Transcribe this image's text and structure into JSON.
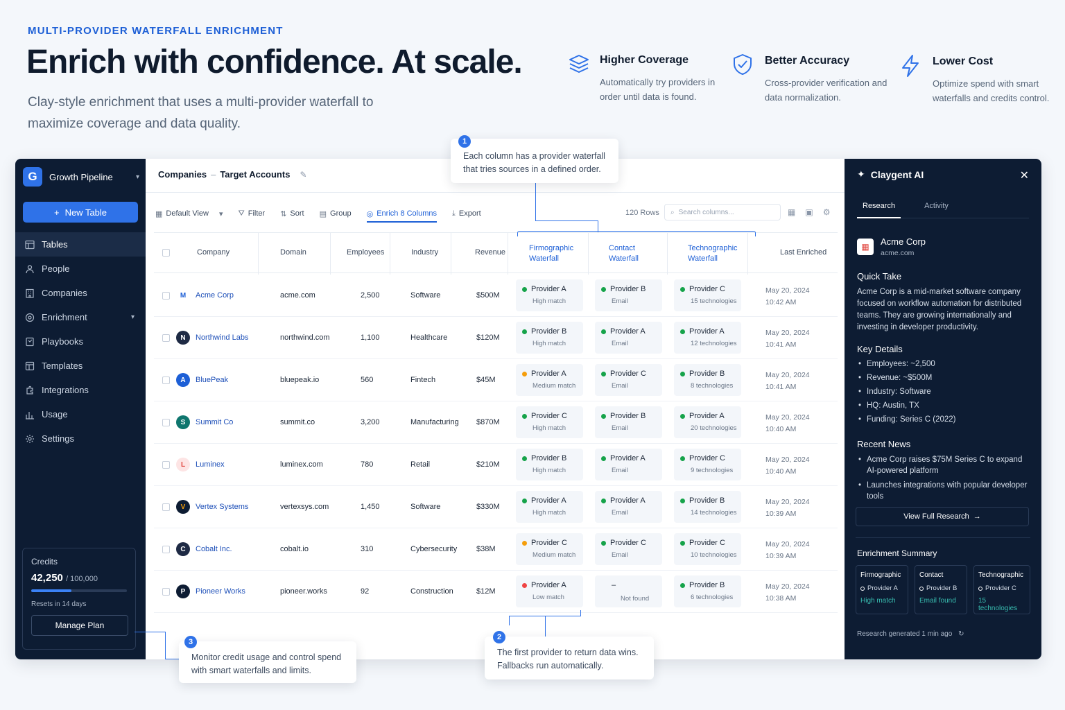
{
  "hero": {
    "eyebrow": "MULTI-PROVIDER WATERFALL ENRICHMENT",
    "title": "Enrich with confidence. At scale.",
    "subtitle": "Clay-style enrichment that uses a multi-provider waterfall to maximize coverage and data quality."
  },
  "features": [
    {
      "icon": "layers-icon",
      "title": "Higher Coverage",
      "desc": "Automatically try providers in order until data is found."
    },
    {
      "icon": "shield-check-icon",
      "title": "Better Accuracy",
      "desc": "Cross-provider verification and data normalization."
    },
    {
      "icon": "lightning-icon",
      "title": "Lower Cost",
      "desc": "Optimize spend with smart waterfalls and credits control."
    }
  ],
  "sidebar": {
    "workspace_initial": "G",
    "workspace": "Growth Pipeline",
    "new_table": "New Table",
    "items": [
      {
        "label": "Tables",
        "icon": "table-icon"
      },
      {
        "label": "People",
        "icon": "people-icon"
      },
      {
        "label": "Companies",
        "icon": "building-icon"
      },
      {
        "label": "Enrichment",
        "icon": "target-icon"
      },
      {
        "label": "Playbooks",
        "icon": "book-icon"
      },
      {
        "label": "Templates",
        "icon": "template-icon"
      },
      {
        "label": "Integrations",
        "icon": "puzzle-icon"
      },
      {
        "label": "Usage",
        "icon": "bar-chart-icon"
      },
      {
        "label": "Settings",
        "icon": "gear-icon"
      }
    ],
    "credits": {
      "label": "Credits",
      "value": "42,250",
      "total": "/ 100,000",
      "used_fraction": 0.4225,
      "reset": "Resets in 14 days",
      "manage": "Manage Plan"
    }
  },
  "table": {
    "breadcrumb_parent": "Companies",
    "breadcrumb_sep": "–",
    "breadcrumb_current": "Target Accounts",
    "toolbar": [
      "Default View",
      "Filter",
      "Sort",
      "Group",
      "Enrich 8 Columns",
      "Export"
    ],
    "rows_count": "120 Rows",
    "search_placeholder": "Search columns...",
    "headers": {
      "company": "Company",
      "domain": "Domain",
      "employees": "Employees",
      "industry": "Industry",
      "revenue": "Revenue",
      "firmo": "Firmographic Waterfall",
      "contact": "Contact Waterfall",
      "techno": "Technographic Waterfall",
      "last": "Last Enriched"
    },
    "rows": [
      {
        "company": "Acme Corp",
        "domain": "acme.com",
        "employees": "2,500",
        "industry": "Software",
        "revenue": "$500M",
        "firmo": {
          "provider": "Provider A",
          "status": "High match",
          "color": "#16a34a"
        },
        "contact": {
          "provider": "Provider B",
          "status": "Email",
          "color": "#16a34a"
        },
        "techno": {
          "provider": "Provider C",
          "status": "15 technologies",
          "color": "#16a34a"
        },
        "date": "May 20, 2024",
        "time": "10:42 AM",
        "logo": "M",
        "logo_bg": "#ffffff",
        "logo_fg": "#1d5fd6"
      },
      {
        "company": "Northwind Labs",
        "domain": "northwind.com",
        "employees": "1,100",
        "industry": "Healthcare",
        "revenue": "$120M",
        "firmo": {
          "provider": "Provider B",
          "status": "High match",
          "color": "#16a34a"
        },
        "contact": {
          "provider": "Provider A",
          "status": "Email",
          "color": "#16a34a"
        },
        "techno": {
          "provider": "Provider A",
          "status": "12 technologies",
          "color": "#16a34a"
        },
        "date": "May 20, 2024",
        "time": "10:41 AM",
        "logo": "N",
        "logo_bg": "#1e2a44",
        "logo_fg": "#ffffff"
      },
      {
        "company": "BluePeak",
        "domain": "bluepeak.io",
        "employees": "560",
        "industry": "Fintech",
        "revenue": "$45M",
        "firmo": {
          "provider": "Provider A",
          "status": "Medium match",
          "color": "#f59e0b"
        },
        "contact": {
          "provider": "Provider C",
          "status": "Email",
          "color": "#16a34a"
        },
        "techno": {
          "provider": "Provider B",
          "status": "8 technologies",
          "color": "#16a34a"
        },
        "date": "May 20, 2024",
        "time": "10:41 AM",
        "logo": "A",
        "logo_bg": "#1d5fd6",
        "logo_fg": "#ffffff"
      },
      {
        "company": "Summit Co",
        "domain": "summit.co",
        "employees": "3,200",
        "industry": "Manufacturing",
        "revenue": "$870M",
        "firmo": {
          "provider": "Provider C",
          "status": "High match",
          "color": "#16a34a"
        },
        "contact": {
          "provider": "Provider B",
          "status": "Email",
          "color": "#16a34a"
        },
        "techno": {
          "provider": "Provider A",
          "status": "20 technologies",
          "color": "#16a34a"
        },
        "date": "May 20, 2024",
        "time": "10:40 AM",
        "logo": "S",
        "logo_bg": "#0f766e",
        "logo_fg": "#ffffff"
      },
      {
        "company": "Luminex",
        "domain": "luminex.com",
        "employees": "780",
        "industry": "Retail",
        "revenue": "$210M",
        "firmo": {
          "provider": "Provider B",
          "status": "High match",
          "color": "#16a34a"
        },
        "contact": {
          "provider": "Provider A",
          "status": "Email",
          "color": "#16a34a"
        },
        "techno": {
          "provider": "Provider C",
          "status": "9 technologies",
          "color": "#16a34a"
        },
        "date": "May 20, 2024",
        "time": "10:40 AM",
        "logo": "L",
        "logo_bg": "#fde4e4",
        "logo_fg": "#e0453e"
      },
      {
        "company": "Vertex Systems",
        "domain": "vertexsys.com",
        "employees": "1,450",
        "industry": "Software",
        "revenue": "$330M",
        "firmo": {
          "provider": "Provider A",
          "status": "High match",
          "color": "#16a34a"
        },
        "contact": {
          "provider": "Provider A",
          "status": "Email",
          "color": "#16a34a"
        },
        "techno": {
          "provider": "Provider B",
          "status": "14 technologies",
          "color": "#16a34a"
        },
        "date": "May 20, 2024",
        "time": "10:39 AM",
        "logo": "V",
        "logo_bg": "#0d1c33",
        "logo_fg": "#f59e0b"
      },
      {
        "company": "Cobalt Inc.",
        "domain": "cobalt.io",
        "employees": "310",
        "industry": "Cybersecurity",
        "revenue": "$38M",
        "firmo": {
          "provider": "Provider C",
          "status": "Medium match",
          "color": "#f59e0b"
        },
        "contact": {
          "provider": "Provider C",
          "status": "Email",
          "color": "#16a34a"
        },
        "techno": {
          "provider": "Provider C",
          "status": "10 technologies",
          "color": "#16a34a"
        },
        "date": "May 20, 2024",
        "time": "10:39 AM",
        "logo": "C",
        "logo_bg": "#1e2a44",
        "logo_fg": "#ffffff"
      },
      {
        "company": "Pioneer Works",
        "domain": "pioneer.works",
        "employees": "92",
        "industry": "Construction",
        "revenue": "$12M",
        "firmo": {
          "provider": "Provider A",
          "status": "Low match",
          "color": "#ef4444"
        },
        "contact": {
          "provider": "–",
          "status": "Not found",
          "color": ""
        },
        "techno": {
          "provider": "Provider B",
          "status": "6 technologies",
          "color": "#16a34a"
        },
        "date": "May 20, 2024",
        "time": "10:38 AM",
        "logo": "P",
        "logo_bg": "#0d1c33",
        "logo_fg": "#ffffff"
      }
    ]
  },
  "panel": {
    "title": "Claygent AI",
    "tabs": [
      "Research",
      "Activity"
    ],
    "company": "Acme Corp",
    "domain": "acme.com",
    "quick_take_label": "Quick Take",
    "quick_take": "Acme Corp is a mid-market software company focused on workflow automation for distributed teams. They are growing internationally and investing in developer productivity.",
    "key_details_label": "Key Details",
    "key_details": [
      "Employees:  ~2,500",
      "Revenue:  ~$500M",
      "Industry:  Software",
      "HQ:  Austin, TX",
      "Funding:  Series C (2022)"
    ],
    "news_label": "Recent News",
    "news": [
      "Acme Corp raises $75M Series C to expand AI-powered platform",
      "Launches integrations with popular developer tools"
    ],
    "view_research": "View Full Research",
    "summary_label": "Enrichment Summary",
    "summary": [
      {
        "title": "Firmographic",
        "provider": "Provider A",
        "status": "High match"
      },
      {
        "title": "Contact",
        "provider": "Provider B",
        "status": "Email found"
      },
      {
        "title": "Technographic",
        "provider": "Provider C",
        "status": "15 technologies"
      }
    ],
    "footer": "Research generated 1 min ago"
  },
  "callouts": [
    {
      "num": "1",
      "text": "Each column has a provider waterfall that tries sources in a defined order."
    },
    {
      "num": "2",
      "text": "The first provider to return data wins. Fallbacks run automatically."
    },
    {
      "num": "3",
      "text": "Monitor credit usage and control spend with smart waterfalls and limits."
    }
  ],
  "colors": {
    "accent": "#2f72e8",
    "sidebar": "#0d1c33",
    "success": "#16a34a",
    "warning": "#f59e0b",
    "danger": "#ef4444",
    "teal": "#38bdb0"
  }
}
